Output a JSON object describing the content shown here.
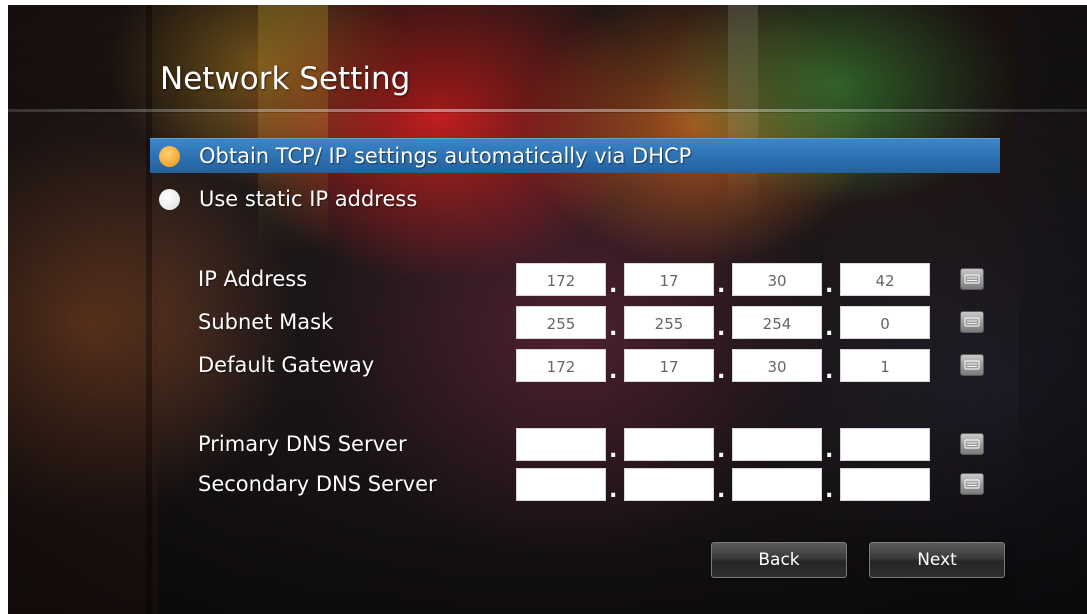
{
  "title": "Network Setting",
  "options": [
    {
      "label": "Obtain TCP/ IP settings automatically via DHCP",
      "selected": true
    },
    {
      "label": "Use static IP address",
      "selected": false
    }
  ],
  "fields": {
    "ip_address": {
      "label": "IP Address",
      "octets": [
        "172",
        "17",
        "30",
        "42"
      ]
    },
    "subnet_mask": {
      "label": "Subnet Mask",
      "octets": [
        "255",
        "255",
        "254",
        "0"
      ]
    },
    "default_gateway": {
      "label": "Default Gateway",
      "octets": [
        "172",
        "17",
        "30",
        "1"
      ]
    },
    "primary_dns": {
      "label": "Primary DNS Server",
      "octets": [
        "",
        "",
        "",
        ""
      ]
    },
    "secondary_dns": {
      "label": "Secondary DNS Server",
      "octets": [
        "",
        "",
        "",
        ""
      ]
    }
  },
  "separator": ".",
  "buttons": {
    "back": "Back",
    "next": "Next"
  },
  "icons": {
    "radio_selected": "radio-selected-icon",
    "radio_unselected": "radio-unselected-icon",
    "keyboard": "keyboard-icon"
  },
  "colors": {
    "selection_bar": "#2f76b8",
    "radio_selected": "#f2a630",
    "radio_unselected": "#ffffff"
  }
}
